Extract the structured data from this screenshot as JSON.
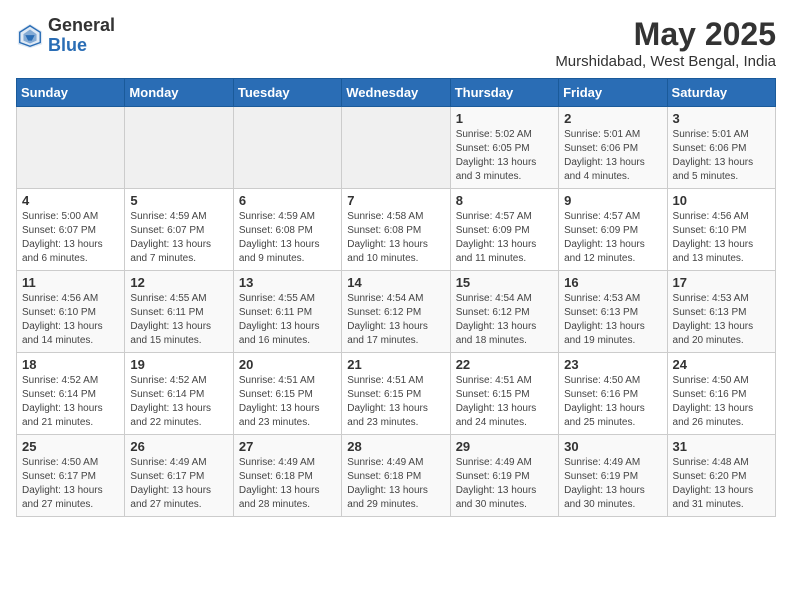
{
  "header": {
    "logo_general": "General",
    "logo_blue": "Blue",
    "month_title": "May 2025",
    "subtitle": "Murshidabad, West Bengal, India"
  },
  "days_of_week": [
    "Sunday",
    "Monday",
    "Tuesday",
    "Wednesday",
    "Thursday",
    "Friday",
    "Saturday"
  ],
  "weeks": [
    {
      "days": [
        {
          "number": "",
          "empty": true
        },
        {
          "number": "",
          "empty": true
        },
        {
          "number": "",
          "empty": true
        },
        {
          "number": "",
          "empty": true
        },
        {
          "number": "1",
          "sunrise": "Sunrise: 5:02 AM",
          "sunset": "Sunset: 6:05 PM",
          "daylight": "Daylight: 13 hours and 3 minutes."
        },
        {
          "number": "2",
          "sunrise": "Sunrise: 5:01 AM",
          "sunset": "Sunset: 6:06 PM",
          "daylight": "Daylight: 13 hours and 4 minutes."
        },
        {
          "number": "3",
          "sunrise": "Sunrise: 5:01 AM",
          "sunset": "Sunset: 6:06 PM",
          "daylight": "Daylight: 13 hours and 5 minutes."
        }
      ]
    },
    {
      "days": [
        {
          "number": "4",
          "sunrise": "Sunrise: 5:00 AM",
          "sunset": "Sunset: 6:07 PM",
          "daylight": "Daylight: 13 hours and 6 minutes."
        },
        {
          "number": "5",
          "sunrise": "Sunrise: 4:59 AM",
          "sunset": "Sunset: 6:07 PM",
          "daylight": "Daylight: 13 hours and 7 minutes."
        },
        {
          "number": "6",
          "sunrise": "Sunrise: 4:59 AM",
          "sunset": "Sunset: 6:08 PM",
          "daylight": "Daylight: 13 hours and 9 minutes."
        },
        {
          "number": "7",
          "sunrise": "Sunrise: 4:58 AM",
          "sunset": "Sunset: 6:08 PM",
          "daylight": "Daylight: 13 hours and 10 minutes."
        },
        {
          "number": "8",
          "sunrise": "Sunrise: 4:57 AM",
          "sunset": "Sunset: 6:09 PM",
          "daylight": "Daylight: 13 hours and 11 minutes."
        },
        {
          "number": "9",
          "sunrise": "Sunrise: 4:57 AM",
          "sunset": "Sunset: 6:09 PM",
          "daylight": "Daylight: 13 hours and 12 minutes."
        },
        {
          "number": "10",
          "sunrise": "Sunrise: 4:56 AM",
          "sunset": "Sunset: 6:10 PM",
          "daylight": "Daylight: 13 hours and 13 minutes."
        }
      ]
    },
    {
      "days": [
        {
          "number": "11",
          "sunrise": "Sunrise: 4:56 AM",
          "sunset": "Sunset: 6:10 PM",
          "daylight": "Daylight: 13 hours and 14 minutes."
        },
        {
          "number": "12",
          "sunrise": "Sunrise: 4:55 AM",
          "sunset": "Sunset: 6:11 PM",
          "daylight": "Daylight: 13 hours and 15 minutes."
        },
        {
          "number": "13",
          "sunrise": "Sunrise: 4:55 AM",
          "sunset": "Sunset: 6:11 PM",
          "daylight": "Daylight: 13 hours and 16 minutes."
        },
        {
          "number": "14",
          "sunrise": "Sunrise: 4:54 AM",
          "sunset": "Sunset: 6:12 PM",
          "daylight": "Daylight: 13 hours and 17 minutes."
        },
        {
          "number": "15",
          "sunrise": "Sunrise: 4:54 AM",
          "sunset": "Sunset: 6:12 PM",
          "daylight": "Daylight: 13 hours and 18 minutes."
        },
        {
          "number": "16",
          "sunrise": "Sunrise: 4:53 AM",
          "sunset": "Sunset: 6:13 PM",
          "daylight": "Daylight: 13 hours and 19 minutes."
        },
        {
          "number": "17",
          "sunrise": "Sunrise: 4:53 AM",
          "sunset": "Sunset: 6:13 PM",
          "daylight": "Daylight: 13 hours and 20 minutes."
        }
      ]
    },
    {
      "days": [
        {
          "number": "18",
          "sunrise": "Sunrise: 4:52 AM",
          "sunset": "Sunset: 6:14 PM",
          "daylight": "Daylight: 13 hours and 21 minutes."
        },
        {
          "number": "19",
          "sunrise": "Sunrise: 4:52 AM",
          "sunset": "Sunset: 6:14 PM",
          "daylight": "Daylight: 13 hours and 22 minutes."
        },
        {
          "number": "20",
          "sunrise": "Sunrise: 4:51 AM",
          "sunset": "Sunset: 6:15 PM",
          "daylight": "Daylight: 13 hours and 23 minutes."
        },
        {
          "number": "21",
          "sunrise": "Sunrise: 4:51 AM",
          "sunset": "Sunset: 6:15 PM",
          "daylight": "Daylight: 13 hours and 23 minutes."
        },
        {
          "number": "22",
          "sunrise": "Sunrise: 4:51 AM",
          "sunset": "Sunset: 6:15 PM",
          "daylight": "Daylight: 13 hours and 24 minutes."
        },
        {
          "number": "23",
          "sunrise": "Sunrise: 4:50 AM",
          "sunset": "Sunset: 6:16 PM",
          "daylight": "Daylight: 13 hours and 25 minutes."
        },
        {
          "number": "24",
          "sunrise": "Sunrise: 4:50 AM",
          "sunset": "Sunset: 6:16 PM",
          "daylight": "Daylight: 13 hours and 26 minutes."
        }
      ]
    },
    {
      "days": [
        {
          "number": "25",
          "sunrise": "Sunrise: 4:50 AM",
          "sunset": "Sunset: 6:17 PM",
          "daylight": "Daylight: 13 hours and 27 minutes."
        },
        {
          "number": "26",
          "sunrise": "Sunrise: 4:49 AM",
          "sunset": "Sunset: 6:17 PM",
          "daylight": "Daylight: 13 hours and 27 minutes."
        },
        {
          "number": "27",
          "sunrise": "Sunrise: 4:49 AM",
          "sunset": "Sunset: 6:18 PM",
          "daylight": "Daylight: 13 hours and 28 minutes."
        },
        {
          "number": "28",
          "sunrise": "Sunrise: 4:49 AM",
          "sunset": "Sunset: 6:18 PM",
          "daylight": "Daylight: 13 hours and 29 minutes."
        },
        {
          "number": "29",
          "sunrise": "Sunrise: 4:49 AM",
          "sunset": "Sunset: 6:19 PM",
          "daylight": "Daylight: 13 hours and 30 minutes."
        },
        {
          "number": "30",
          "sunrise": "Sunrise: 4:49 AM",
          "sunset": "Sunset: 6:19 PM",
          "daylight": "Daylight: 13 hours and 30 minutes."
        },
        {
          "number": "31",
          "sunrise": "Sunrise: 4:48 AM",
          "sunset": "Sunset: 6:20 PM",
          "daylight": "Daylight: 13 hours and 31 minutes."
        }
      ]
    }
  ]
}
